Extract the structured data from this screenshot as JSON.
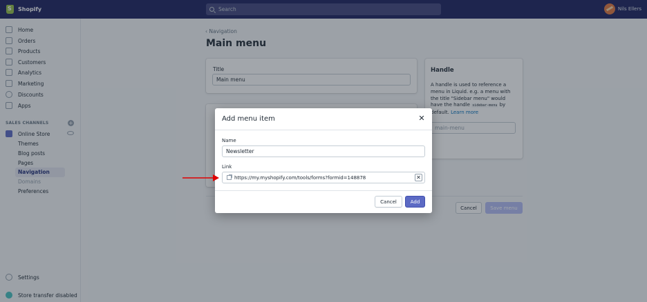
{
  "topbar": {
    "brand": "Shopify",
    "search_placeholder": "Search",
    "user_name": "Nils Ellers"
  },
  "sidebar": {
    "items": [
      {
        "label": "Home",
        "icon": "home-icon"
      },
      {
        "label": "Orders",
        "icon": "orders-icon"
      },
      {
        "label": "Products",
        "icon": "tag-icon"
      },
      {
        "label": "Customers",
        "icon": "person-icon"
      },
      {
        "label": "Analytics",
        "icon": "bar-chart-icon"
      },
      {
        "label": "Marketing",
        "icon": "megaphone-icon"
      },
      {
        "label": "Discounts",
        "icon": "discount-icon"
      },
      {
        "label": "Apps",
        "icon": "apps-icon"
      }
    ],
    "sales_channels_title": "SALES CHANNELS",
    "online_store": "Online Store",
    "sub_items": [
      "Themes",
      "Blog posts",
      "Pages",
      "Navigation",
      "Domains",
      "Preferences"
    ],
    "settings": "Settings",
    "store_transfer": "Store transfer disabled"
  },
  "main": {
    "breadcrumb": "Navigation",
    "title": "Main menu",
    "title_label": "Title",
    "title_value": "Main menu",
    "handle": {
      "title": "Handle",
      "desc_1": "A handle is used to reference a menu in Liquid. e.g. a menu with the title \"Sidebar menu\" would have the handle",
      "code": "sidebar-menu",
      "desc_2": "by default.",
      "learn_more": "Learn more",
      "value": "main-menu"
    },
    "cancel": "Cancel",
    "save": "Save menu"
  },
  "modal": {
    "title": "Add menu item",
    "name_label": "Name",
    "name_value": "Newsletter",
    "link_label": "Link",
    "link_value": "https://my.myshopify.com/tools/forms?formid=148878",
    "cancel": "Cancel",
    "add": "Add"
  },
  "colors": {
    "topbar": "#1c2260",
    "primary": "#5c6ac4",
    "annotation_arrow": "#e00000"
  }
}
